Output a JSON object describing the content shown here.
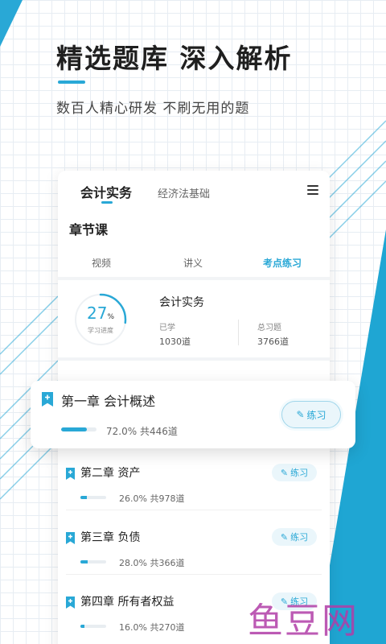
{
  "header": {
    "headline": "精选题库  深入解析",
    "subline": "数百人精心研发 不刷无用的题"
  },
  "card": {
    "tabs": [
      {
        "label": "会计实务",
        "active": true
      },
      {
        "label": "经济法基础",
        "active": false
      }
    ],
    "menu_icon": "hamburger-menu-icon",
    "section_title": "章节课",
    "subtabs": [
      {
        "label": "视频",
        "active": false
      },
      {
        "label": "讲义",
        "active": false
      },
      {
        "label": "考点练习",
        "active": true
      }
    ],
    "progress": {
      "value": "27",
      "unit": "%",
      "label": "学习进度",
      "fraction": 0.27
    },
    "course": {
      "name": "会计实务",
      "learned_label": "已学",
      "learned_value": "1030道",
      "total_label": "总习题",
      "total_value": "3766道"
    }
  },
  "featured_chapter": {
    "title": "第一章 会计概述",
    "percent": "72.0%",
    "count": "共446道",
    "progress": 0.72,
    "button_label": "练习",
    "icon": "bookmark-plus-icon"
  },
  "chapters": [
    {
      "title": "第二章 资产",
      "percent": "26.0%",
      "count": "共978道",
      "progress": 0.26,
      "button_label": "练习"
    },
    {
      "title": "第三章 负债",
      "percent": "28.0%",
      "count": "共366道",
      "progress": 0.28,
      "button_label": "练习"
    },
    {
      "title": "第四章 所有者权益",
      "percent": "16.0%",
      "count": "共270道",
      "progress": 0.16,
      "button_label": "练习"
    }
  ],
  "watermark": "鱼豆网",
  "colors": {
    "accent": "#29a8d6",
    "accent_light": "#eaf6fb",
    "watermark": "#b13ea7"
  }
}
